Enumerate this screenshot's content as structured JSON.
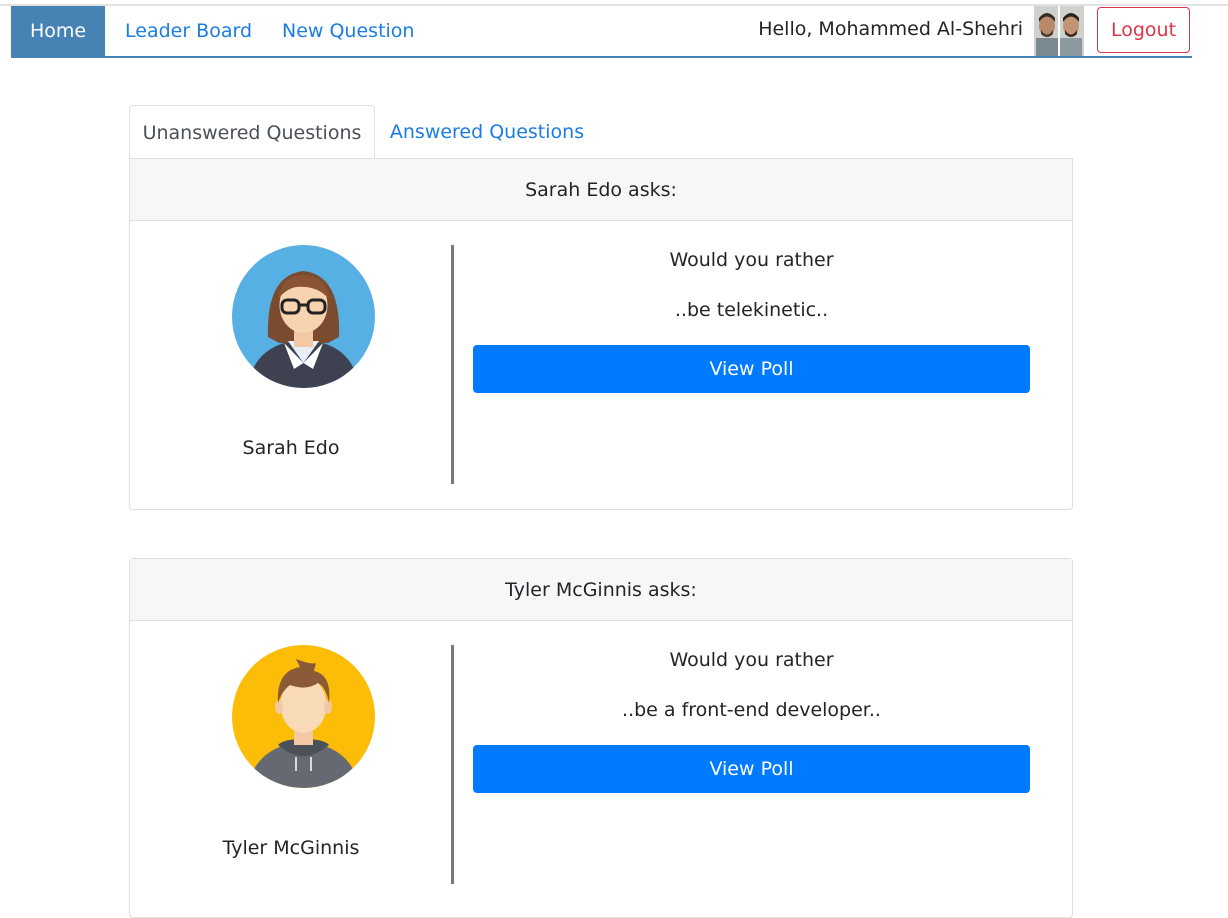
{
  "nav": {
    "home": "Home",
    "leader_board": "Leader Board",
    "new_question": "New Question",
    "greeting": "Hello, Mohammed Al-Shehri",
    "logout": "Logout"
  },
  "tabs": {
    "unanswered": "Unanswered Questions",
    "answered": "Answered Questions"
  },
  "questions": [
    {
      "header": "Sarah Edo asks:",
      "author": "Sarah Edo",
      "avatar_icon": "woman-avatar-icon",
      "prompt": "Would you rather",
      "option": "..be telekinetic..",
      "button": "View Poll"
    },
    {
      "header": "Tyler McGinnis asks:",
      "author": "Tyler McGinnis",
      "avatar_icon": "man-avatar-icon",
      "prompt": "Would you rather",
      "option": "..be a front-end developer..",
      "button": "View Poll"
    }
  ],
  "colors": {
    "nav_active": "#4682b4",
    "link": "#1a7de6",
    "primary_button": "#007bff",
    "logout": "#dc3545"
  }
}
